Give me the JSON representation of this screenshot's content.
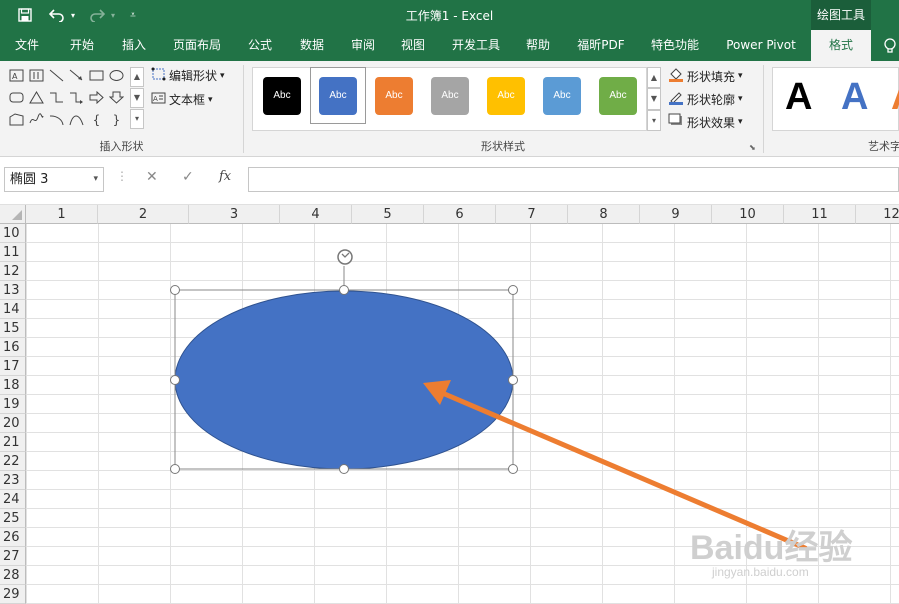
{
  "titlebar": {
    "title": "工作簿1  -  Excel",
    "context_tab_title": "绘图工具",
    "quick_access": [
      "save-icon",
      "undo-icon",
      "redo-icon",
      "customize-qat-icon"
    ]
  },
  "tabs": [
    {
      "label": "文件"
    },
    {
      "label": "开始"
    },
    {
      "label": "插入"
    },
    {
      "label": "页面布局"
    },
    {
      "label": "公式"
    },
    {
      "label": "数据"
    },
    {
      "label": "审阅"
    },
    {
      "label": "视图"
    },
    {
      "label": "开发工具"
    },
    {
      "label": "帮助"
    },
    {
      "label": "福昕PDF"
    },
    {
      "label": "特色功能"
    },
    {
      "label": "Power Pivot"
    },
    {
      "label": "格式",
      "active": true
    }
  ],
  "ribbon": {
    "insert_shapes": {
      "label": "插入形状",
      "edit_shape": "编辑形状",
      "text_box": "文本框"
    },
    "shape_styles": {
      "label": "形状样式",
      "styles": [
        {
          "text": "Abc",
          "color": "#000000"
        },
        {
          "text": "Abc",
          "color": "#4472C4",
          "selected": true
        },
        {
          "text": "Abc",
          "color": "#ED7D31"
        },
        {
          "text": "Abc",
          "color": "#A5A5A5"
        },
        {
          "text": "Abc",
          "color": "#FFC000"
        },
        {
          "text": "Abc",
          "color": "#5B9BD5"
        },
        {
          "text": "Abc",
          "color": "#70AD47"
        }
      ],
      "fill": "形状填充",
      "outline": "形状轮廓",
      "effects": "形状效果"
    },
    "wordart": {
      "label": "艺术字"
    }
  },
  "formula_bar": {
    "name_box": "椭圆 3",
    "fx": "fx",
    "cancel_icon": "close-icon",
    "enter_icon": "check-icon",
    "value": ""
  },
  "grid": {
    "columns": [
      "1",
      "2",
      "3",
      "4",
      "5",
      "6",
      "7",
      "8",
      "9",
      "10",
      "11",
      "12"
    ],
    "rows": [
      "10",
      "11",
      "12",
      "13",
      "14",
      "15",
      "16",
      "17",
      "18",
      "19",
      "20",
      "21",
      "22",
      "23",
      "24",
      "25",
      "26",
      "27",
      "28",
      "29"
    ]
  },
  "shape": {
    "name": "椭圆 3",
    "fill": "#4472C4",
    "outline": "#2F528F"
  },
  "annotation": {
    "arrow_color": "#ED7D31"
  },
  "watermark": {
    "text": "Baidu经验",
    "sub": "jingyan.baidu.com"
  }
}
